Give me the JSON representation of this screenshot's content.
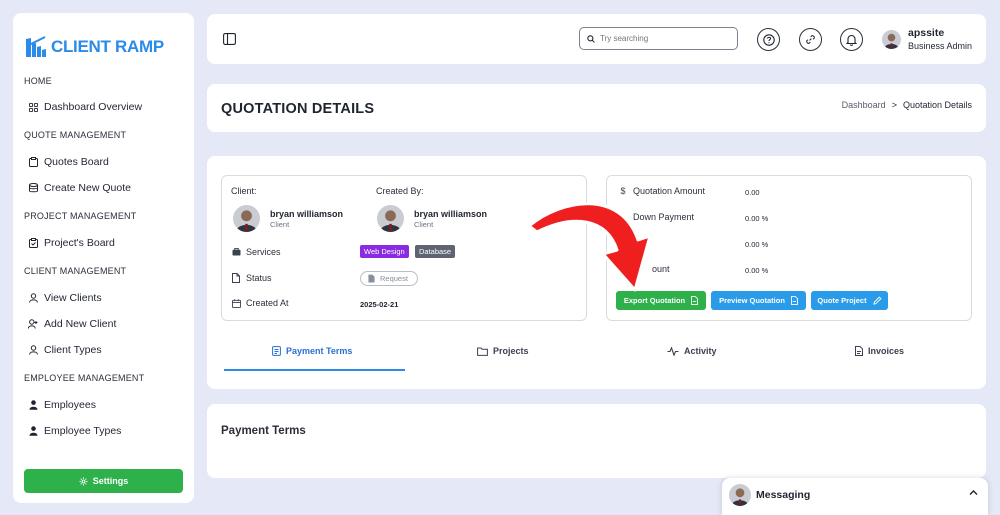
{
  "brand": {
    "name": "CLIENT RAMP",
    "color": "#2a8be8"
  },
  "sidebar": {
    "sections": [
      {
        "title": "HOME",
        "items": [
          {
            "label": "Dashboard Overview",
            "icon": "grid-icon"
          }
        ]
      },
      {
        "title": "QUOTE MANAGEMENT",
        "items": [
          {
            "label": "Quotes Board",
            "icon": "clipboard-icon"
          },
          {
            "label": "Create New Quote",
            "icon": "database-icon"
          }
        ]
      },
      {
        "title": "PROJECT MANAGEMENT",
        "items": [
          {
            "label": "Project's Board",
            "icon": "clipboard-check-icon"
          }
        ]
      },
      {
        "title": "CLIENT MANAGEMENT",
        "items": [
          {
            "label": "View Clients",
            "icon": "user-icon"
          },
          {
            "label": "Add New Client",
            "icon": "user-plus-icon"
          },
          {
            "label": "Client Types",
            "icon": "user-icon"
          }
        ]
      },
      {
        "title": "EMPLOYEE MANAGEMENT",
        "items": [
          {
            "label": "Employees",
            "icon": "person-icon"
          },
          {
            "label": "Employee Types",
            "icon": "person-icon"
          }
        ]
      }
    ],
    "settings_label": "Settings"
  },
  "topbar": {
    "search_placeholder": "Try searching",
    "user": {
      "name": "apssite",
      "role": "Business Admin"
    }
  },
  "page": {
    "title": "QUOTATION DETAILS",
    "breadcrumb": {
      "parent": "Dashboard",
      "separator": ">",
      "current": "Quotation Details"
    }
  },
  "details": {
    "client_label": "Client:",
    "created_by_label": "Created By:",
    "client": {
      "name": "bryan williamson",
      "role": "Client"
    },
    "created_by": {
      "name": "bryan williamson",
      "role": "Client"
    },
    "services_label": "Services",
    "services": [
      {
        "label": "Web Design",
        "color": "#8a2be2"
      },
      {
        "label": "Database",
        "color": "#5f6470"
      }
    ],
    "status_label": "Status",
    "status_value": "Request",
    "created_at_label": "Created At",
    "created_at_value": "2025-02-21"
  },
  "quotation": {
    "amount_label": "Quotation Amount",
    "amount_value": "0.00",
    "down_payment_label": "Down Payment",
    "down_payment_value": "0.00 %",
    "row3_value": "0.00 %",
    "discount_label_partial": "ount",
    "discount_value": "0.00 %",
    "buttons": {
      "export": {
        "label": "Export Quotation",
        "color": "#2eb04b"
      },
      "preview": {
        "label": "Preview Quotation",
        "color": "#2a9be8"
      },
      "quote_project": {
        "label": "Quote Project",
        "color": "#2a9be8"
      }
    }
  },
  "tabs": [
    {
      "label": "Payment Terms",
      "icon": "document-icon",
      "active": true
    },
    {
      "label": "Projects",
      "icon": "folder-icon",
      "active": false
    },
    {
      "label": "Activity",
      "icon": "activity-icon",
      "active": false
    },
    {
      "label": "Invoices",
      "icon": "invoice-icon",
      "active": false
    }
  ],
  "payment_terms": {
    "title": "Payment Terms"
  },
  "messaging": {
    "label": "Messaging"
  }
}
